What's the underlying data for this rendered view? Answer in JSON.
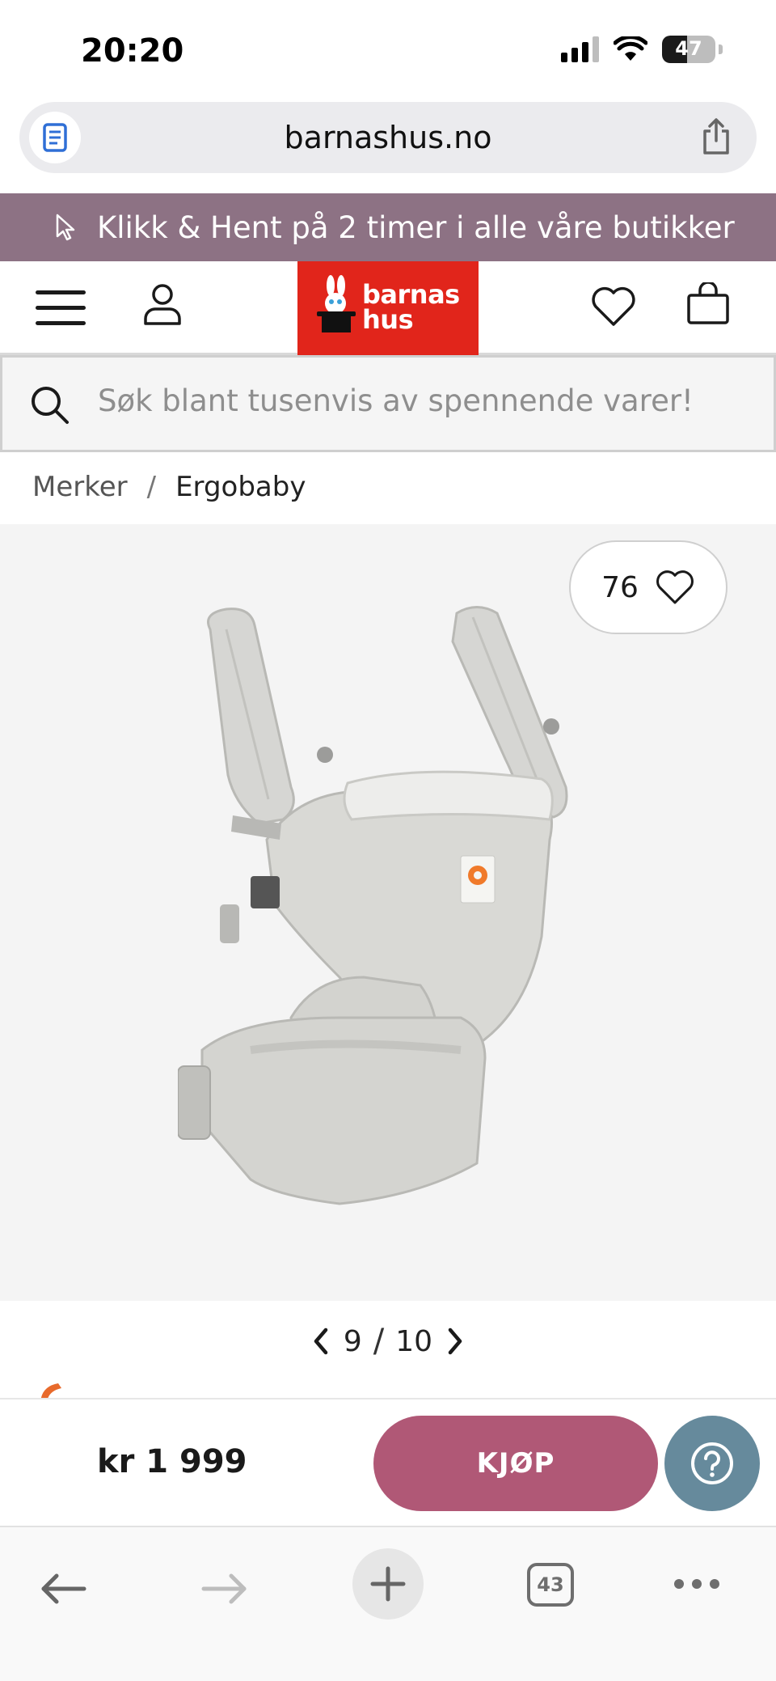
{
  "status_bar": {
    "time": "20:20",
    "battery_level": "47",
    "battery_fraction": 0.47
  },
  "url_bar": {
    "url": "barnashus.no"
  },
  "promo": {
    "text": "Klikk & Hent på 2 timer i alle våre butikker"
  },
  "header": {
    "logo_line1": "barnas",
    "logo_line2": "hus",
    "logo_color": "#e1251b"
  },
  "search": {
    "placeholder": "Søk blant tusenvis av spennende varer!"
  },
  "breadcrumb": {
    "parent": "Merker",
    "separator": "/",
    "current": "Ergobaby"
  },
  "gallery": {
    "favorites_count": "76",
    "current_image": "9",
    "separator": "/",
    "total_images": "10"
  },
  "buy_bar": {
    "price": "kr 1 999",
    "buy_label": "KJØP",
    "buy_color": "#b05876",
    "help_color": "#668a9c"
  },
  "toolbar": {
    "tabs_count": "43"
  },
  "colors": {
    "promo_bg": "#8d7284",
    "accent": "#b05876"
  }
}
